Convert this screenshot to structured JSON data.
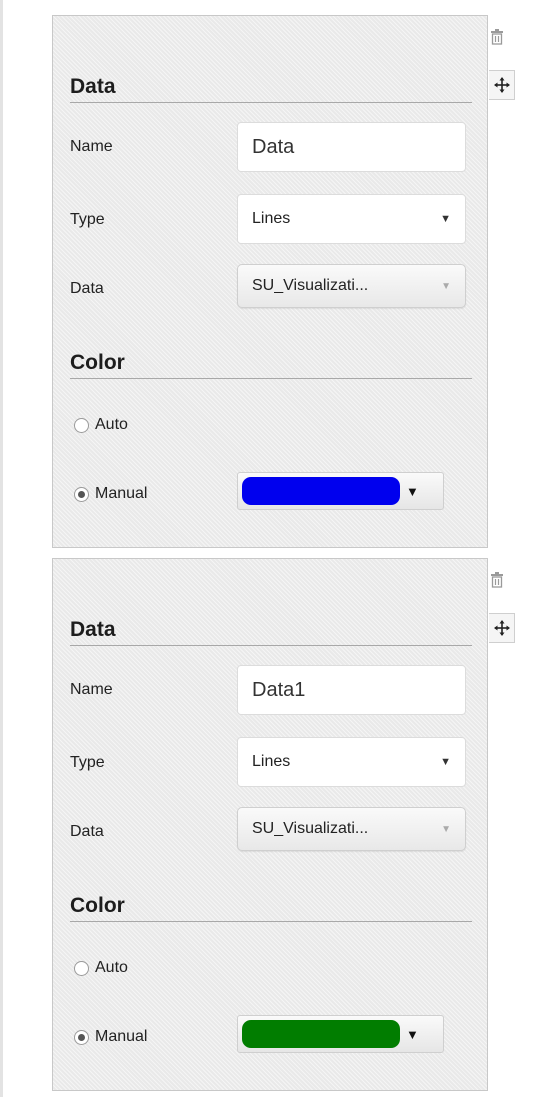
{
  "panels": [
    {
      "data_section_title": "Data",
      "name_label": "Name",
      "name_value": "Data",
      "type_label": "Type",
      "type_value": "Lines",
      "data_label": "Data",
      "data_value": "SU_Visualizati...",
      "color_section_title": "Color",
      "auto_label": "Auto",
      "manual_label": "Manual",
      "selected_mode": "Manual",
      "color": "#0000ee"
    },
    {
      "data_section_title": "Data",
      "name_label": "Name",
      "name_value": "Data1",
      "type_label": "Type",
      "type_value": "Lines",
      "data_label": "Data",
      "data_value": "SU_Visualizati...",
      "color_section_title": "Color",
      "auto_label": "Auto",
      "manual_label": "Manual",
      "selected_mode": "Manual",
      "color": "#017d00"
    }
  ],
  "icons": {
    "delete": "trash-icon",
    "move": "move-icon",
    "dropdown": "caret-down-icon"
  }
}
